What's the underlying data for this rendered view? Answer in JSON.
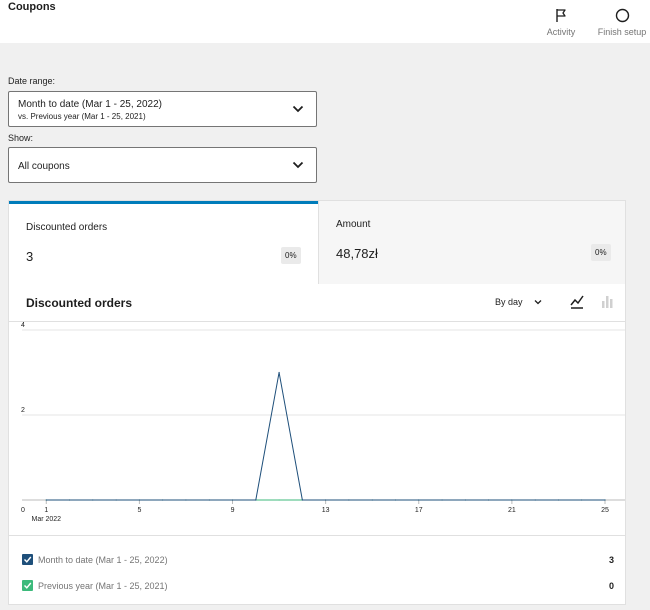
{
  "header": {
    "title": "Coupons",
    "actions": [
      {
        "label": "Activity",
        "icon": "flag-icon"
      },
      {
        "label": "Finish setup",
        "icon": "circle-icon"
      }
    ]
  },
  "filters": {
    "date_range": {
      "label": "Date range:",
      "value": "Month to date (Mar 1 - 25, 2022)",
      "compare": "vs. Previous year (Mar 1 - 25, 2021)"
    },
    "show": {
      "label": "Show:",
      "value": "All coupons"
    }
  },
  "summary": [
    {
      "label": "Discounted orders",
      "value": "3",
      "delta": "0%",
      "selected": true
    },
    {
      "label": "Amount",
      "value": "48,78zł",
      "delta": "0%",
      "selected": false
    }
  ],
  "chart_header": {
    "title": "Discounted orders",
    "interval": "By day",
    "line_icon": "line-chart-icon",
    "bar_icon": "bar-chart-icon"
  },
  "legend": [
    {
      "label": "Month to date (Mar 1 - 25, 2022)",
      "value": "3",
      "color": "#1e4f7a"
    },
    {
      "label": "Previous year (Mar 1 - 25, 2021)",
      "value": "0",
      "color": "#3cba7b"
    }
  ],
  "colors": {
    "accent": "#007cba",
    "current_series": "#1e4f7a",
    "previous_series": "#3cba7b"
  },
  "chart_data": {
    "type": "line",
    "title": "",
    "xlabel": "",
    "ylabel": "",
    "x": [
      1,
      2,
      3,
      4,
      5,
      6,
      7,
      8,
      9,
      10,
      11,
      12,
      13,
      14,
      15,
      16,
      17,
      18,
      19,
      20,
      21,
      22,
      23,
      24,
      25
    ],
    "x_ticks": [
      "0",
      "1",
      "5",
      "9",
      "13",
      "17",
      "21",
      "25"
    ],
    "x_tick_values": [
      0,
      1,
      5,
      9,
      13,
      17,
      21,
      25
    ],
    "x_sublabel": "Mar 2022",
    "y_ticks": [
      "2",
      "4"
    ],
    "y_tick_values": [
      2,
      4
    ],
    "ylim": [
      0,
      4
    ],
    "xlim": [
      0,
      25
    ],
    "grid": true,
    "series": [
      {
        "name": "Month to date (Mar 1 - 25, 2022)",
        "color": "#1e4f7a",
        "values": [
          0,
          0,
          0,
          0,
          0,
          0,
          0,
          0,
          0,
          0,
          3,
          0,
          0,
          0,
          0,
          0,
          0,
          0,
          0,
          0,
          0,
          0,
          0,
          0,
          0
        ]
      },
      {
        "name": "Previous year (Mar 1 - 25, 2021)",
        "color": "#3cba7b",
        "values": [
          0,
          0,
          0,
          0,
          0,
          0,
          0,
          0,
          0,
          0,
          0,
          0,
          0,
          0,
          0,
          0,
          0,
          0,
          0,
          0,
          0,
          0,
          0,
          0,
          0
        ]
      }
    ]
  }
}
